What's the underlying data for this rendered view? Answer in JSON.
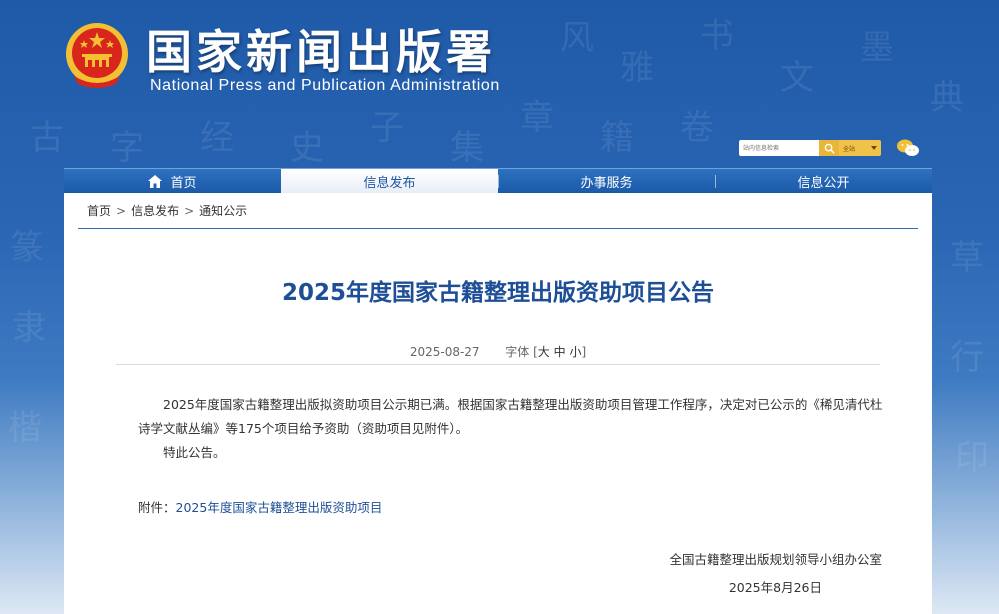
{
  "header": {
    "site_title": "国家新闻出版署",
    "site_subtitle": "National Press and Publication Administration",
    "search_placeholder": "站内信息检索",
    "search_scope": "全站"
  },
  "nav": {
    "items": [
      {
        "label": "首页",
        "icon": "home-icon"
      },
      {
        "label": "信息发布",
        "active": true
      },
      {
        "label": "办事服务"
      },
      {
        "label": "信息公开"
      }
    ]
  },
  "breadcrumb": {
    "items": [
      "首页",
      "信息发布",
      "通知公示"
    ],
    "separator": ">"
  },
  "article": {
    "title": "2025年度国家古籍整理出版资助项目公告",
    "date": "2025-08-27",
    "font_label": "字体",
    "font_open": "[",
    "font_large": "大",
    "font_medium": "中",
    "font_small": "小",
    "font_close": "]",
    "paragraph1": "2025年度国家古籍整理出版拟资助项目公示期已满。根据国家古籍整理出版资助项目管理工作程序，决定对已公示的《稀见清代杜诗学文献丛编》等175个项目给予资助（资助项目见附件）。",
    "paragraph2": "特此公告。",
    "attachment_label": "附件：",
    "attachment_link": "2025年度国家古籍整理出版资助项目",
    "signature_org": "全国古籍整理出版规划领导小组办公室",
    "signature_date": "2025年8月26日"
  },
  "colors": {
    "accent": "#1e4f96",
    "nav_bg": "#1b5aa8",
    "emblem_red": "#d8261c",
    "emblem_gold": "#f3c033"
  }
}
